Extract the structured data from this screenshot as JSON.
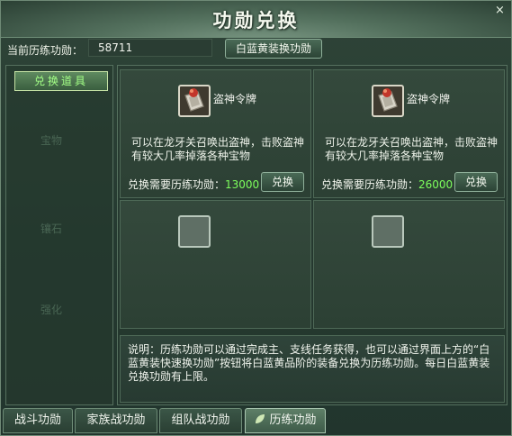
{
  "window": {
    "title": "功勋兑换",
    "close_glyph": "×"
  },
  "header": {
    "current_label": "当前历练功勋：",
    "current_value": "58711",
    "convert_button": "白蓝黄装换功勋"
  },
  "sidebar": {
    "items": [
      {
        "label": "兑换道具"
      }
    ],
    "faded": [
      "宝物",
      "镶石",
      "强化"
    ]
  },
  "slots": [
    {
      "name": "盗神令牌",
      "icon": "thief-token-icon",
      "desc_lines": [
        "可以在龙牙关召唤出盗神，击败盗神",
        "有较大几率掉落各种宝物"
      ],
      "cost_label": "兑换需要历练功勋：",
      "cost_value": "13000",
      "button": "兑换"
    },
    {
      "name": "盗神令牌",
      "icon": "thief-token-icon",
      "desc_lines": [
        "可以在龙牙关召唤出盗神，击败盗神",
        "有较大几率掉落各种宝物"
      ],
      "cost_label": "兑换需要历练功勋：",
      "cost_value": "26000",
      "button": "兑换"
    },
    {
      "empty": true
    },
    {
      "empty": true
    }
  ],
  "description": {
    "lines": [
      "说明：历练功勋可以通过完成主、支线任务获得，也可以通过界面上方的“白",
      "蓝黄装快速换功勋”按钮将白蓝黄品阶的装备兑换为历练功勋。每日白蓝黄装",
      "兑换功勋有上限。"
    ]
  },
  "tabs": [
    {
      "label": "战斗功勋"
    },
    {
      "label": "家族战功勋"
    },
    {
      "label": "组队战功勋"
    },
    {
      "label": "历练功勋",
      "active": true
    }
  ],
  "colors": {
    "cost_value": "#7dff5c",
    "active_sidebar_text": "#a3ff86"
  }
}
